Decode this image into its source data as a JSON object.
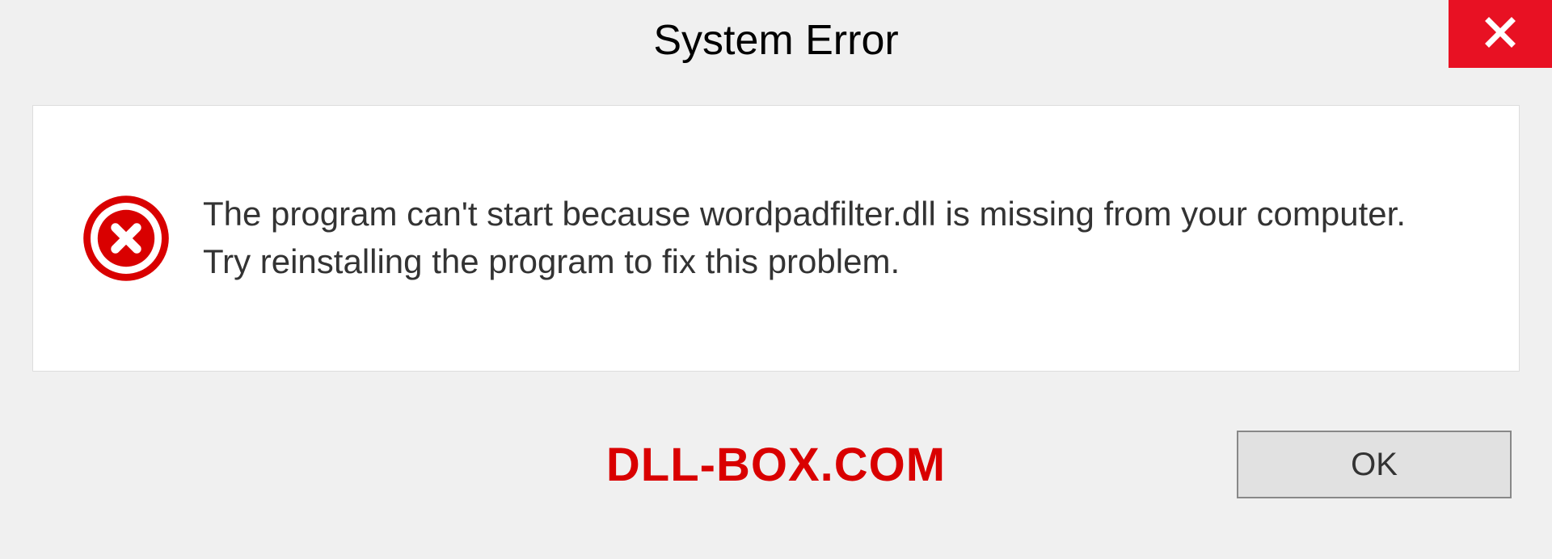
{
  "dialog": {
    "title": "System Error",
    "message": "The program can't start because wordpadfilter.dll is missing from your computer. Try reinstalling the program to fix this problem.",
    "ok_label": "OK"
  },
  "watermark": "DLL-BOX.COM"
}
